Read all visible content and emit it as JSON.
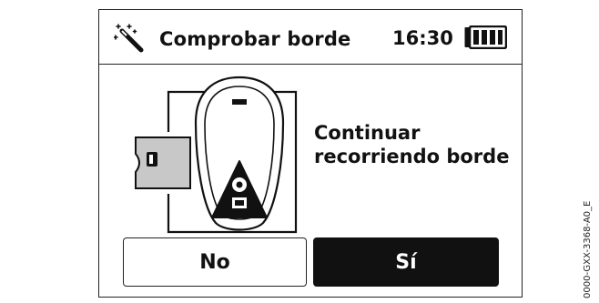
{
  "header": {
    "title": "Comprobar borde",
    "time": "16:30",
    "wand_icon": "magic-wand-icon",
    "battery_icon": "battery-full-icon"
  },
  "main": {
    "message_line1": "Continuar",
    "message_line2": "recorriendo borde",
    "illustration_icon": "mower-at-charging-station-icon"
  },
  "buttons": {
    "no_label": "No",
    "si_label": "Sí"
  },
  "document_ref": "0000-GXX-3368-A0_E"
}
